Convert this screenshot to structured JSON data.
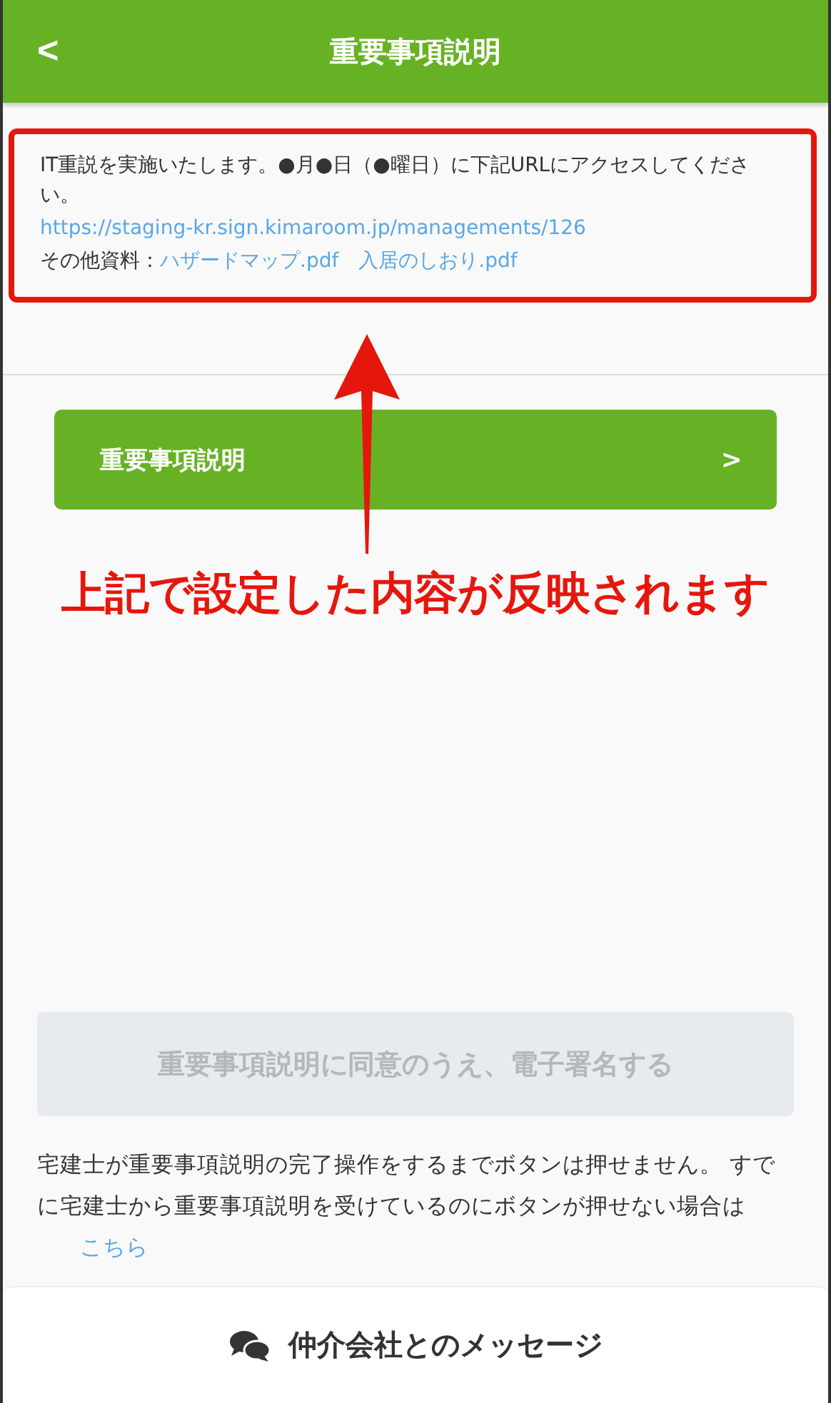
{
  "header": {
    "back": "<",
    "title": "重要事項説明"
  },
  "notice": {
    "text": "IT重説を実施いたします。●月●日（●曜日）に下記URLにアクセスしてください。",
    "url": "https://staging-kr.sign.kimaroom.jp/managements/126",
    "materials_label": "その他資料：",
    "materials": [
      "ハザードマップ.pdf",
      "入居のしおり.pdf"
    ]
  },
  "explanation_button": {
    "label": "重要事項説明",
    "chevron": ">"
  },
  "annotation": "上記で設定した内容が反映されます",
  "sign_button": {
    "label": "重要事項説明に同意のうえ、電子署名する",
    "disabled": true
  },
  "note": {
    "text": "宅建士が重要事項説明の完了操作をするまでボタンは押せません。 すでに宅建士から重要事項説明を受けているのにボタンが押せない場合は",
    "link": "こちら"
  },
  "footer": {
    "label": "仲介会社とのメッセージ"
  }
}
